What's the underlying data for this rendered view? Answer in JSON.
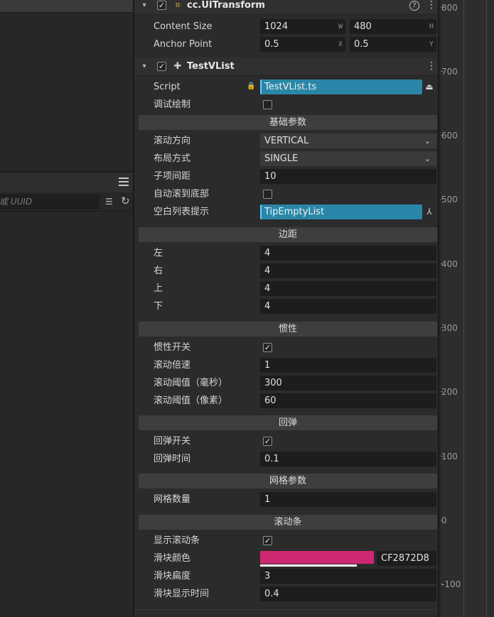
{
  "left_panel": {
    "search_placeholder": "或 UUID",
    "menu_icon": "hamburger-icon",
    "sort_icon": "sort-list-icon",
    "refresh_icon": "refresh-icon"
  },
  "uitransform": {
    "title": "cc.UITransform",
    "enabled": true,
    "content_size_label": "Content Size",
    "width": "1024",
    "width_suffix": "W",
    "height": "480",
    "height_suffix": "H",
    "anchor_label": "Anchor Point",
    "anchor_x": "0.5",
    "anchor_x_suffix": "X",
    "anchor_y": "0.5",
    "anchor_y_suffix": "Y"
  },
  "testvlist": {
    "title": "TestVList",
    "enabled": true,
    "script_label": "Script",
    "script_value": "TestVList.ts",
    "debug_draw_label": "调试绘制",
    "debug_draw": false,
    "basic_section": "基础参数",
    "scroll_dir_label": "滚动方向",
    "scroll_dir_value": "VERTICAL",
    "layout_label": "布局方式",
    "layout_value": "SINGLE",
    "item_spacing_label": "子项间距",
    "item_spacing_value": "10",
    "auto_scroll_bottom_label": "自动滚到底部",
    "auto_scroll_bottom": false,
    "empty_tip_label": "空白列表提示",
    "empty_tip_value": "TipEmptyList",
    "padding_section": "边距",
    "left_label": "左",
    "left_value": "4",
    "right_label": "右",
    "right_value": "4",
    "top_label": "上",
    "top_value": "4",
    "bottom_label": "下",
    "bottom_value": "4",
    "inertia_section": "惯性",
    "inertia_toggle_label": "惯性开关",
    "inertia_toggle": true,
    "scroll_speed_label": "滚动倍速",
    "scroll_speed_value": "1",
    "threshold_ms_label": "滚动阈值（毫秒）",
    "threshold_ms_value": "300",
    "threshold_px_label": "滚动阈值（像素）",
    "threshold_px_value": "60",
    "bounce_section": "回弹",
    "bounce_toggle_label": "回弹开关",
    "bounce_toggle": true,
    "bounce_time_label": "回弹时间",
    "bounce_time_value": "0.1",
    "grid_section": "网格参数",
    "grid_count_label": "网格数量",
    "grid_count_value": "1",
    "scrollbar_section": "滚动条",
    "show_scrollbar_label": "显示滚动条",
    "show_scrollbar": true,
    "thumb_color_label": "滑块颜色",
    "thumb_color_hex": "CF2872D8",
    "thumb_color": "#cf2872",
    "thumb_width_label": "滑块扁度",
    "thumb_width_value": "3",
    "thumb_show_time_label": "滑块显示时间",
    "thumb_show_time_value": "0.4"
  },
  "ruler": {
    "ticks": [
      "800",
      "700",
      "600",
      "500",
      "400",
      "300",
      "200",
      "100",
      "0",
      "-100"
    ]
  }
}
